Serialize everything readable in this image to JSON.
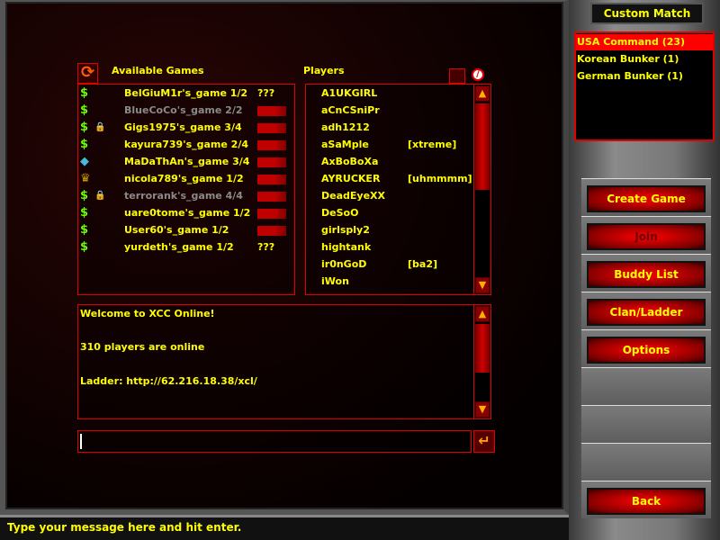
{
  "games_header": "Available Games",
  "players_header": "Players",
  "games": [
    {
      "icon": "dollar-icon",
      "locked": false,
      "name": "BelGiuM1r's_game 1/2",
      "status": "???",
      "full": false
    },
    {
      "icon": "dollar-icon",
      "locked": false,
      "name": "BlueCoCo's_game 2/2",
      "status": "bar",
      "full": true
    },
    {
      "icon": "dollar-icon",
      "locked": true,
      "name": "Gigs1975's_game 3/4",
      "status": "bar",
      "full": false
    },
    {
      "icon": "dollar-icon",
      "locked": false,
      "name": "kayura739's_game 2/4",
      "status": "bar",
      "full": false
    },
    {
      "icon": "crystal-icon",
      "locked": false,
      "name": "MaDaThAn's_game 3/4",
      "status": "bar",
      "full": false
    },
    {
      "icon": "trophy-icon",
      "locked": false,
      "name": "nicola789's_game 1/2",
      "status": "bar",
      "full": false
    },
    {
      "icon": "dollar-icon",
      "locked": true,
      "name": "terrorank's_game 4/4",
      "status": "bar",
      "full": true
    },
    {
      "icon": "dollar-icon",
      "locked": false,
      "name": "uare0tome's_game 1/2",
      "status": "bar",
      "full": false
    },
    {
      "icon": "dollar-icon",
      "locked": false,
      "name": "User60's_game 1/2",
      "status": "bar",
      "full": false
    },
    {
      "icon": "dollar-icon",
      "locked": false,
      "name": "yurdeth's_game 1/2",
      "status": "???",
      "full": false
    }
  ],
  "players": [
    {
      "name": "A1UKGIRL",
      "clan": ""
    },
    {
      "name": "aCnCSniPr",
      "clan": ""
    },
    {
      "name": "adh1212",
      "clan": ""
    },
    {
      "name": "aSaMple",
      "clan": "[xtreme]"
    },
    {
      "name": "AxBoBoXa",
      "clan": ""
    },
    {
      "name": "AYRUCKER",
      "clan": "[uhmmmm]"
    },
    {
      "name": "DeadEyeXX",
      "clan": ""
    },
    {
      "name": "DeSoO",
      "clan": ""
    },
    {
      "name": "girlsply2",
      "clan": ""
    },
    {
      "name": "hightank",
      "clan": ""
    },
    {
      "name": "ir0nGoD",
      "clan": "[ba2]"
    },
    {
      "name": "iWon",
      "clan": ""
    }
  ],
  "chat": [
    "Welcome to XCC Online!",
    "310 players are online",
    "Ladder: http://62.216.18.38/xcl/"
  ],
  "chat_input": "",
  "status_text": "Type your message here and hit enter.",
  "side": {
    "title": "Custom Match",
    "rooms": [
      {
        "label": "USA Command  (23)",
        "selected": true
      },
      {
        "label": "Korean Bunker  (1)",
        "selected": false
      },
      {
        "label": "German Bunker  (1)",
        "selected": false
      }
    ],
    "buttons": [
      {
        "label": "Create Game",
        "enabled": true
      },
      {
        "label": "Join",
        "enabled": false
      },
      {
        "label": "Buddy List",
        "enabled": true
      },
      {
        "label": "Clan/Ladder",
        "enabled": true
      },
      {
        "label": "Options",
        "enabled": true
      },
      null,
      null,
      null,
      {
        "label": "Back",
        "enabled": true
      }
    ]
  },
  "colors": {
    "accent": "#e00000",
    "text": "#ffff00",
    "disabled_text": "#8a8a8a",
    "selected_row": "#ff0000"
  }
}
